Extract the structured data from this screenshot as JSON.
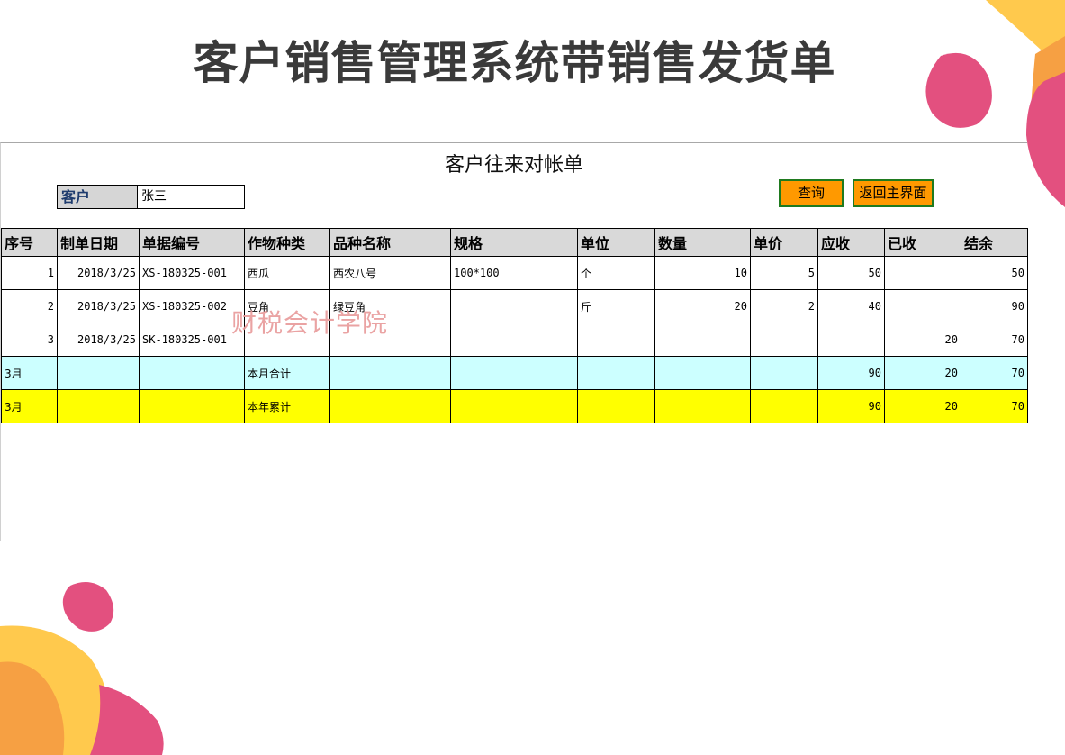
{
  "page_title": "客户销售管理系统带销售发货单",
  "sheet": {
    "title": "客户往来对帐单",
    "customer_label": "客户",
    "customer_value": "张三",
    "buttons": {
      "query": "查询",
      "back": "返回主界面"
    },
    "watermark": "财税会计学院",
    "columns": [
      "序号",
      "制单日期",
      "单据编号",
      "作物种类",
      "品种名称",
      "规格",
      "单位",
      "数量",
      "单价",
      "应收",
      "已收",
      "结余"
    ],
    "rows": [
      [
        "1",
        "2018/3/25",
        "XS-180325-001",
        "西瓜",
        "西农八号",
        "100*100",
        "个",
        "10",
        "5",
        "50",
        "",
        "50"
      ],
      [
        "2",
        "2018/3/25",
        "XS-180325-002",
        "豆角",
        "绿豆角",
        "",
        "斤",
        "20",
        "2",
        "40",
        "",
        "90"
      ],
      [
        "3",
        "2018/3/25",
        "SK-180325-001",
        "",
        "",
        "",
        "",
        "",
        "",
        "",
        "20",
        "70"
      ]
    ],
    "month_total": [
      "3月",
      "",
      "",
      "本月合计",
      "",
      "",
      "",
      "",
      "",
      "90",
      "20",
      "70"
    ],
    "year_total": [
      "3月",
      "",
      "",
      "本年累计",
      "",
      "",
      "",
      "",
      "",
      "90",
      "20",
      "70"
    ]
  },
  "colors": {
    "button_bg": "#ff9900",
    "button_border": "#1f7a1f",
    "month_row": "#ccffff",
    "year_row": "#ffff00",
    "header_bg": "#d9d9d9"
  }
}
